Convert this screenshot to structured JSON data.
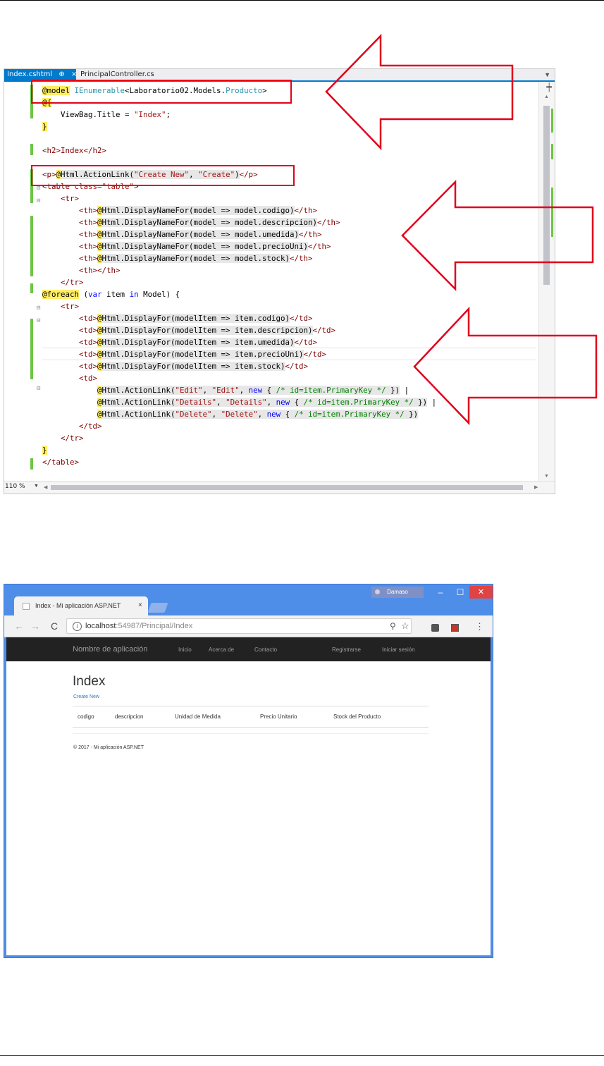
{
  "editor": {
    "tabs": [
      {
        "label": "Index.cshtml",
        "pin": "⊕",
        "close": "×"
      },
      {
        "label": "PrincipalController.cs"
      }
    ],
    "zoom": "110 %",
    "lines": [
      [
        "@model",
        " ",
        "IEnumerable",
        "<Laboratorio02.Models.",
        "Producto",
        ">"
      ],
      [
        "@{"
      ],
      [
        "    ViewBag.Title = ",
        "\"Index\"",
        ";"
      ],
      [
        "}"
      ],
      [
        ""
      ],
      [
        "<h2>Index</h2>"
      ],
      [
        ""
      ],
      [
        "<p>",
        "@",
        "Html.ActionLink(",
        "\"Create New\"",
        ", ",
        "\"Create\"",
        ")",
        "</p>"
      ],
      [
        "<table ",
        "class",
        "=",
        "\"table\"",
        ">"
      ],
      [
        "    <tr>"
      ],
      [
        "        <th>",
        "@",
        "Html.DisplayNameFor(model => model.codigo)",
        "</th>"
      ],
      [
        "        <th>",
        "@",
        "Html.DisplayNameFor(model => model.descripcion)",
        "</th>"
      ],
      [
        "        <th>",
        "@",
        "Html.DisplayNameFor(model => model.umedida)",
        "</th>"
      ],
      [
        "        <th>",
        "@",
        "Html.DisplayNameFor(model => model.precioUni)",
        "</th>"
      ],
      [
        "        <th>",
        "@",
        "Html.DisplayNameFor(model => model.stock)",
        "</th>"
      ],
      [
        "        <th></th>"
      ],
      [
        "    </tr>"
      ],
      [
        "@foreach",
        " (",
        "var",
        " item ",
        "in",
        " Model) {"
      ],
      [
        "    <tr>"
      ],
      [
        "        <td>",
        "@",
        "Html.DisplayFor(modelItem => item.codigo)",
        "</td>"
      ],
      [
        "        <td>",
        "@",
        "Html.DisplayFor(modelItem => item.descripcion)",
        "</td>"
      ],
      [
        "        <td>",
        "@",
        "Html.DisplayFor(modelItem => item.umedida)",
        "</td>"
      ],
      [
        "        <td>",
        "@",
        "Html.DisplayFor(modelItem => item.precioUni)",
        "</td>"
      ],
      [
        "        <td>",
        "@",
        "Html.DisplayFor(modelItem => item.stock)",
        "</td>"
      ],
      [
        "        <td>"
      ],
      [
        "            ",
        "@",
        "Html.ActionLink(",
        "\"Edit\"",
        ", ",
        "\"Edit\"",
        ", ",
        "new",
        " { ",
        "/* id=item.PrimaryKey */",
        " })",
        " |"
      ],
      [
        "            ",
        "@",
        "Html.ActionLink(",
        "\"Details\"",
        ", ",
        "\"Details\"",
        ", ",
        "new",
        " { ",
        "/* id=item.PrimaryKey */",
        " })",
        " |"
      ],
      [
        "            ",
        "@",
        "Html.ActionLink(",
        "\"Delete\"",
        ", ",
        "\"Delete\"",
        ", ",
        "new",
        " { ",
        "/* id=item.PrimaryKey */",
        " })"
      ],
      [
        "        </td>"
      ],
      [
        "    </tr>"
      ],
      [
        "}"
      ],
      [
        "</table>"
      ]
    ]
  },
  "browser": {
    "user": "Damaso",
    "window_controls": {
      "minimize": "–",
      "maximize": "☐",
      "close": "✕"
    },
    "tab_title": "Index - Mi aplicación ASP.NET",
    "tab_close": "×",
    "nav": {
      "back": "←",
      "forward": "→",
      "reload": "C"
    },
    "url_host": "localhost",
    "url_rest": ":54987/Principal/Index",
    "icons": {
      "zoom": "zoom-icon",
      "star": "star-icon",
      "menu": "menu-icon"
    }
  },
  "site": {
    "brand": "Nombre de aplicación",
    "nav_links": [
      "Inicio",
      "Acerca de",
      "Contacto"
    ],
    "right_links": [
      "Registrarse",
      "Iniciar sesión"
    ],
    "heading": "Index",
    "create_link": "Create New",
    "table_headers": [
      "codigo",
      "descripcion",
      "Unidad de Medida",
      "Precio Unitario",
      "Stock del Producto"
    ],
    "footer": "© 2017 - Mi aplicación ASP.NET"
  },
  "annotation_color": "#e0001b"
}
